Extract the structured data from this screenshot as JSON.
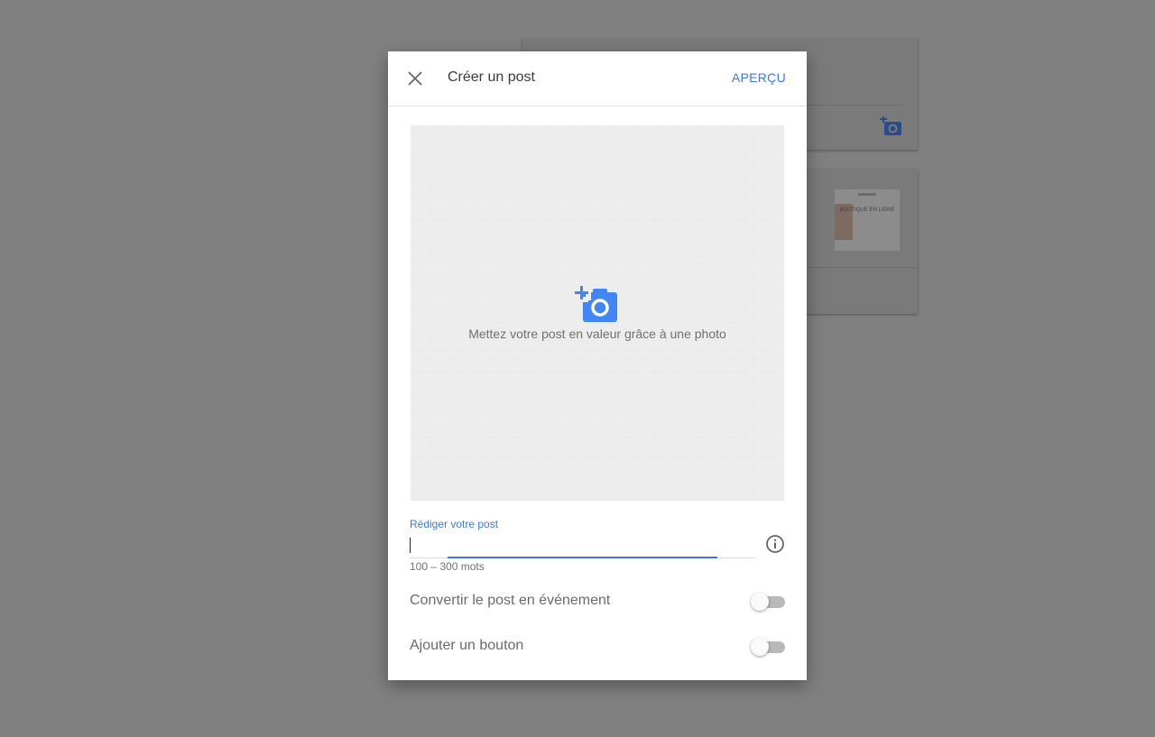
{
  "dialog": {
    "title": "Créer un post",
    "preview_label": "APERÇU"
  },
  "photo": {
    "hint": "Mettez votre post en valeur grâce à une photo",
    "icon": "add-photo-icon"
  },
  "post": {
    "label": "Rédiger votre post",
    "value": "",
    "helper": "100 – 300 mots"
  },
  "toggles": [
    {
      "label": "Convertir le post en événement",
      "on": false
    },
    {
      "label": "Ajouter un bouton",
      "on": false
    }
  ],
  "background": {
    "thumbnail_text": "BOUTIQUE EN LIGNE"
  },
  "colors": {
    "accent": "#3b78e7",
    "overlay": "#808080"
  }
}
